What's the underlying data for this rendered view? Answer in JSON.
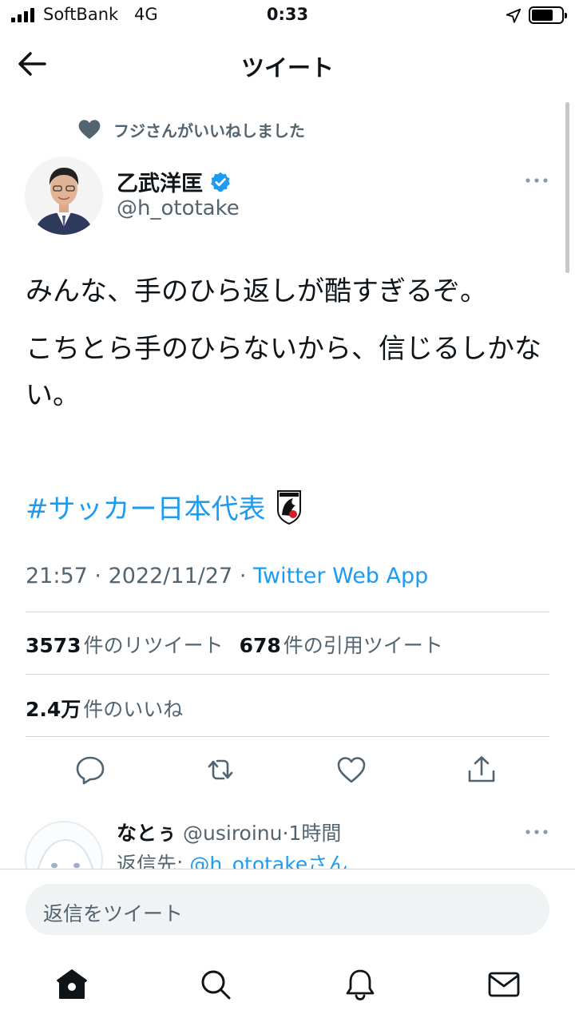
{
  "status_bar": {
    "carrier": "SoftBank",
    "network": "4G",
    "time": "0:33"
  },
  "header": {
    "title": "ツイート"
  },
  "tweet": {
    "social_context": "フジさんがいいねしました",
    "author": {
      "name": "乙武洋匡",
      "handle": "@h_ototake",
      "verified": true
    },
    "text_lines": [
      "みんな、手のひら返しが酷すぎるぞ。",
      "こちとら手のひらないから、信じるしかない。"
    ],
    "hashtag": "#サッカー日本代表",
    "time": "21:57",
    "separator": "·",
    "date": "2022/11/27",
    "source": "Twitter Web App",
    "retweets": {
      "count": "3573",
      "label": "件のリツイート"
    },
    "quotes": {
      "count": "678",
      "label": "件の引用ツイート"
    },
    "likes": {
      "count": "2.4万",
      "label": "件のいいね"
    }
  },
  "reply": {
    "name": "なとぅ",
    "handle": "@usiroinu",
    "separator": "·",
    "time": "1時間",
    "reply_to_prefix": "返信先: ",
    "reply_to_handle": "@h_ototake",
    "reply_to_suffix": "さん"
  },
  "compose": {
    "placeholder": "返信をツイート"
  },
  "icons": {
    "back": "arrow-left-icon",
    "like_context": "heart-filled-icon",
    "verified": "verified-badge-icon",
    "more": "more-dots-icon",
    "reply": "reply-icon",
    "retweet": "retweet-icon",
    "like": "heart-icon",
    "share": "share-icon",
    "home": "home-icon",
    "search": "search-icon",
    "notifications": "bell-icon",
    "messages": "envelope-icon"
  },
  "colors": {
    "accent": "#1d9bf0",
    "secondary_text": "#536471",
    "primary_text": "#0f1419"
  }
}
